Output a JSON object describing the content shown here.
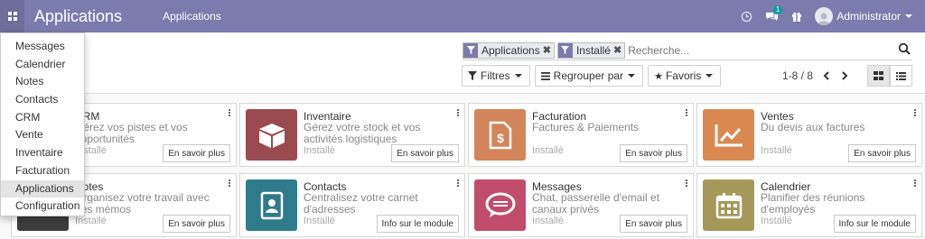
{
  "navbar": {
    "brand": "Applications",
    "menu": "Applications",
    "chat_badge": "1",
    "user_name": "Administrator",
    "bg": "#7c7bad"
  },
  "search": {
    "facets": [
      {
        "label": "Applications",
        "icon": "filter-icon"
      },
      {
        "label": "Installé",
        "icon": "filter-icon"
      }
    ],
    "placeholder": "Recherche..."
  },
  "buttons": {
    "filters": "Filtres",
    "group_by": "Regrouper par",
    "favorites": "Favoris"
  },
  "pager": {
    "value": "1-8 / 8"
  },
  "dropdown": {
    "items": [
      "Messages",
      "Calendrier",
      "Notes",
      "Contacts",
      "CRM",
      "Vente",
      "Inventaire",
      "Facturation",
      "Applications",
      "Configuration"
    ],
    "active": "Applications"
  },
  "cards": [
    {
      "title": "CRM",
      "desc": "Gérez vos pistes et vos opportunités",
      "status": "Installé",
      "action": "En savoir plus",
      "icon": "crm-icon",
      "color": "#3d3d3d"
    },
    {
      "title": "Inventaire",
      "desc": "Gérez votre stock et vos activités logistiques",
      "status": "Installé",
      "action": "En savoir plus",
      "icon": "box-icon",
      "color": "#9a4b52"
    },
    {
      "title": "Facturation",
      "desc": "Factures & Paiements",
      "status": "Installé",
      "action": "En savoir plus",
      "icon": "invoice-icon",
      "color": "#d3845a"
    },
    {
      "title": "Ventes",
      "desc": "Du devis aux factures",
      "status": "Installé",
      "action": "En savoir plus",
      "icon": "chart-icon",
      "color": "#d98950"
    },
    {
      "title": "Notes",
      "desc": "Organisez votre travail avec des mémos",
      "status": "Installé",
      "action": "En savoir plus",
      "icon": "notes-icon",
      "color": "#3d3d3d"
    },
    {
      "title": "Contacts",
      "desc": "Centralisez votre carnet d'adresses",
      "status": "Installé",
      "action": "Info sur le module",
      "icon": "contacts-icon",
      "color": "#2f7b8a"
    },
    {
      "title": "Messages",
      "desc": "Chat, passerelle d'email et canaux privés",
      "status": "Installé",
      "action": "En savoir plus",
      "icon": "chat-bubble-icon",
      "color": "#c14d6d"
    },
    {
      "title": "Calendrier",
      "desc": "Planifier des réunions d'employés",
      "status": "Installé",
      "action": "Info sur le module",
      "icon": "calendar-icon",
      "color": "#a5995a"
    }
  ]
}
